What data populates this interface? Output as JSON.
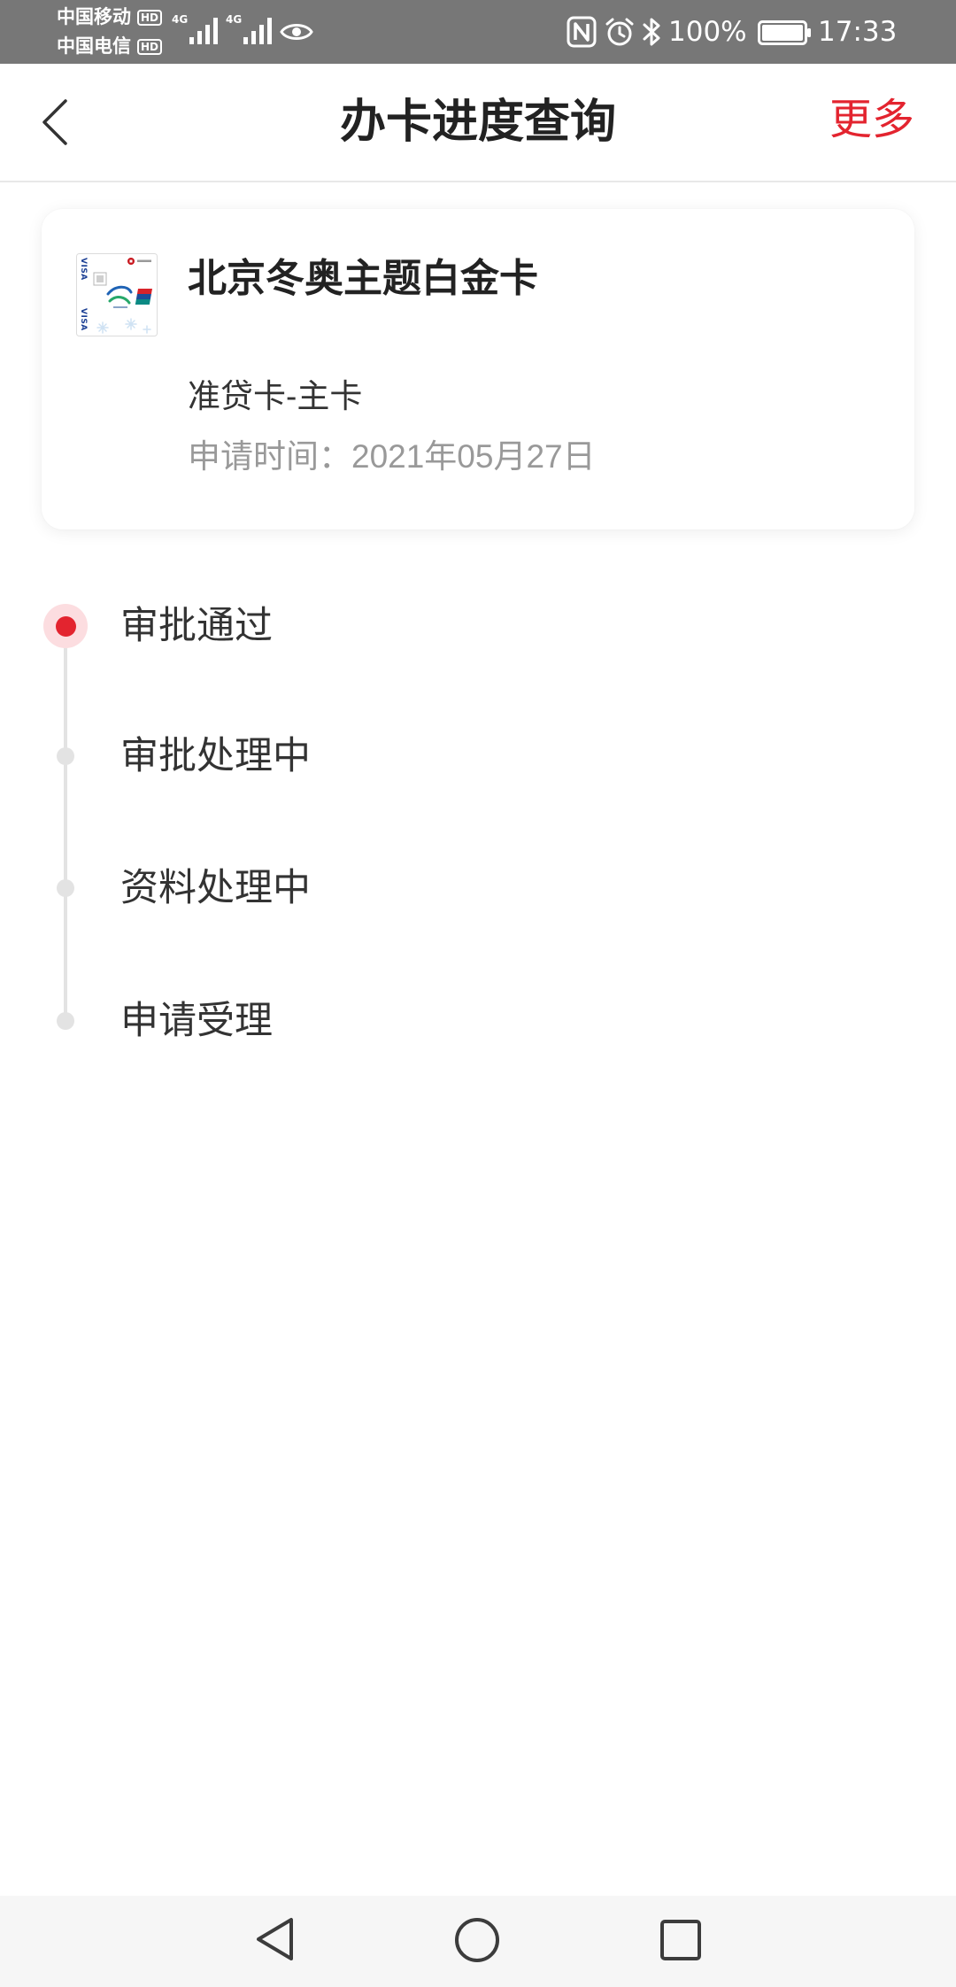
{
  "colors": {
    "accent": "#e3242f",
    "accent_halo": "#fcdde0",
    "status_bar_bg": "#777777",
    "text_primary": "#333333",
    "text_secondary": "#999999",
    "timeline": "#e3e3e3",
    "nav_bar_bg": "#f6f6f6"
  },
  "status_bar": {
    "carriers": [
      {
        "name": "中国移动",
        "badge": "HD"
      },
      {
        "name": "中国电信",
        "badge": "HD"
      }
    ],
    "signals": [
      {
        "network": "4G",
        "bars": 4
      },
      {
        "network": "4G",
        "bars": 4
      }
    ],
    "battery_text": "100%",
    "battery_level": 1,
    "time": "17:33",
    "icons": [
      "signal-icon",
      "eye-icon",
      "nfc-icon",
      "alarm-icon",
      "bluetooth-icon",
      "battery-icon"
    ]
  },
  "header": {
    "title": "办卡进度查询",
    "more_label": "更多",
    "back_icon": "chevron-left-icon"
  },
  "card": {
    "thumbnail_icon": "credit-card-thumbnail",
    "thumbnail_brand": "VISA",
    "name": "北京冬奥主题白金卡",
    "type": "准贷卡-主卡",
    "apply_time": "申请时间：2021年05月27日"
  },
  "progress": {
    "steps": [
      {
        "label": "审批通过",
        "active": true
      },
      {
        "label": "审批处理中",
        "active": false
      },
      {
        "label": "资料处理中",
        "active": false
      },
      {
        "label": "申请受理",
        "active": false
      }
    ]
  },
  "nav_bar": {
    "icons": [
      "nav-back-icon",
      "nav-home-icon",
      "nav-recents-icon"
    ]
  }
}
